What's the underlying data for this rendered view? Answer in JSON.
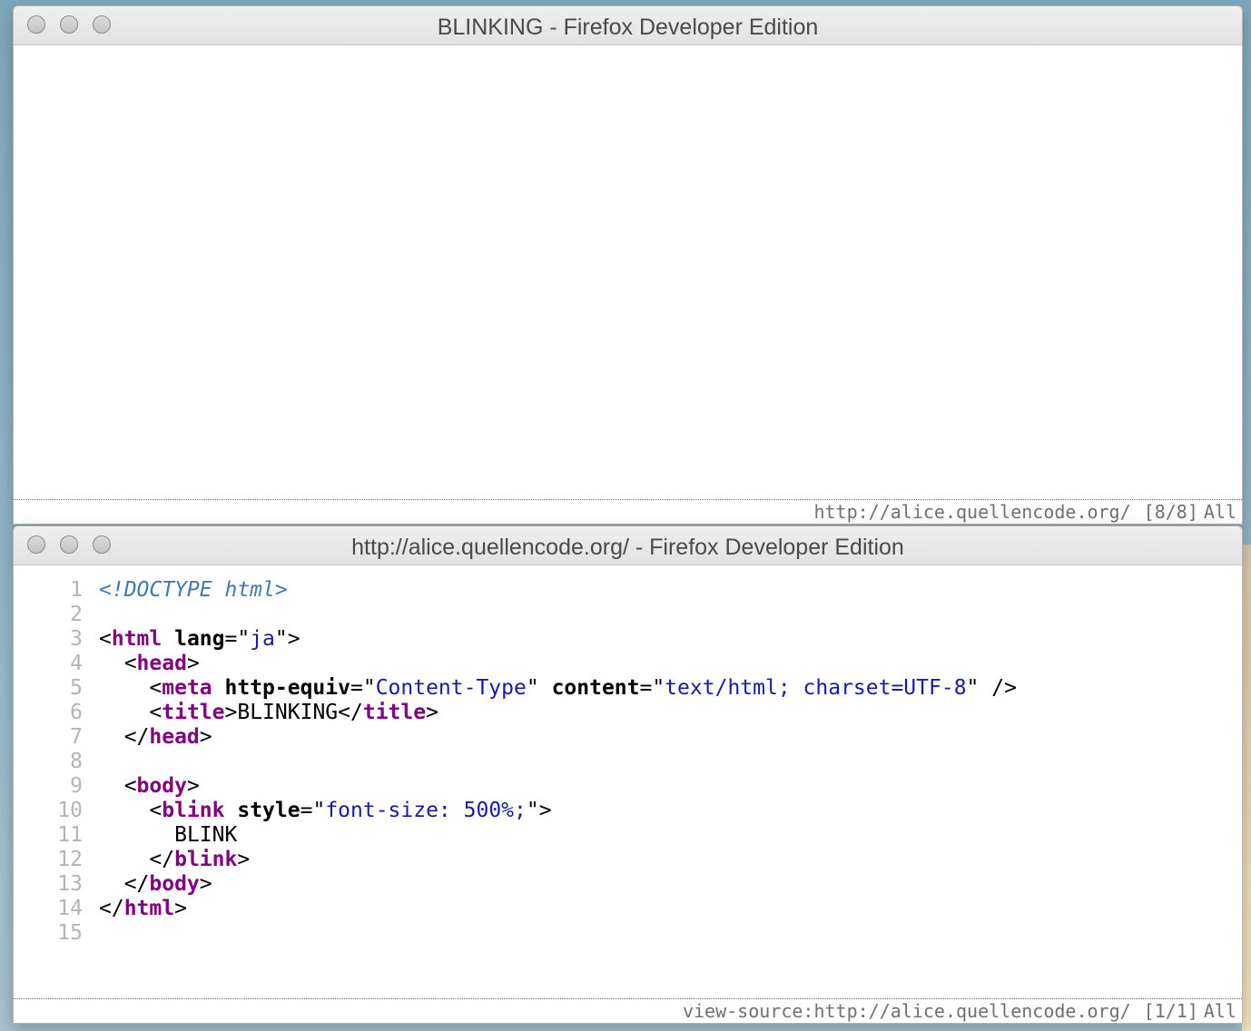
{
  "windows": [
    {
      "title": "BLINKING - Firefox Developer Edition",
      "status": {
        "url": "http://alice.quellencode.org/",
        "position": "[8/8]",
        "scroll": "All"
      }
    },
    {
      "title": "http://alice.quellencode.org/ - Firefox Developer Edition",
      "status": {
        "url": "view-source:http://alice.quellencode.org/",
        "position": "[1/1]",
        "scroll": "All"
      }
    }
  ],
  "source": {
    "line_numbers": [
      "1",
      "2",
      "3",
      "4",
      "5",
      "6",
      "7",
      "8",
      "9",
      "10",
      "11",
      "12",
      "13",
      "14",
      "15"
    ],
    "doctype": "<!DOCTYPE html>",
    "html_tag": "html",
    "lang_attr": "lang",
    "lang_value": "ja",
    "head_tag": "head",
    "meta_tag": "meta",
    "http_equiv_attr": "http-equiv",
    "http_equiv_value": "Content-Type",
    "content_attr": "content",
    "content_value": "text/html; charset=UTF-8",
    "title_tag": "title",
    "title_text": "BLINKING",
    "body_tag": "body",
    "blink_tag": "blink",
    "style_attr": "style",
    "style_value": "font-size: 500%;",
    "blink_text": "BLINK"
  }
}
